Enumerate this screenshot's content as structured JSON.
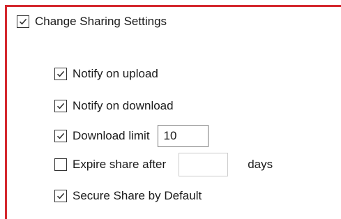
{
  "main": {
    "label": "Change Sharing Settings",
    "checked": true
  },
  "options": {
    "notify_upload": {
      "label": "Notify on upload",
      "checked": true
    },
    "notify_download": {
      "label": "Notify on download",
      "checked": true
    },
    "download_limit": {
      "label": "Download limit",
      "checked": true,
      "value": "10"
    },
    "expire_share": {
      "label": "Expire share after",
      "checked": false,
      "value": "",
      "suffix": "days"
    },
    "secure_share": {
      "label": "Secure Share by Default",
      "checked": true
    }
  },
  "colors": {
    "frame_accent": "#d4282e",
    "checkbox_border": "#333333"
  }
}
